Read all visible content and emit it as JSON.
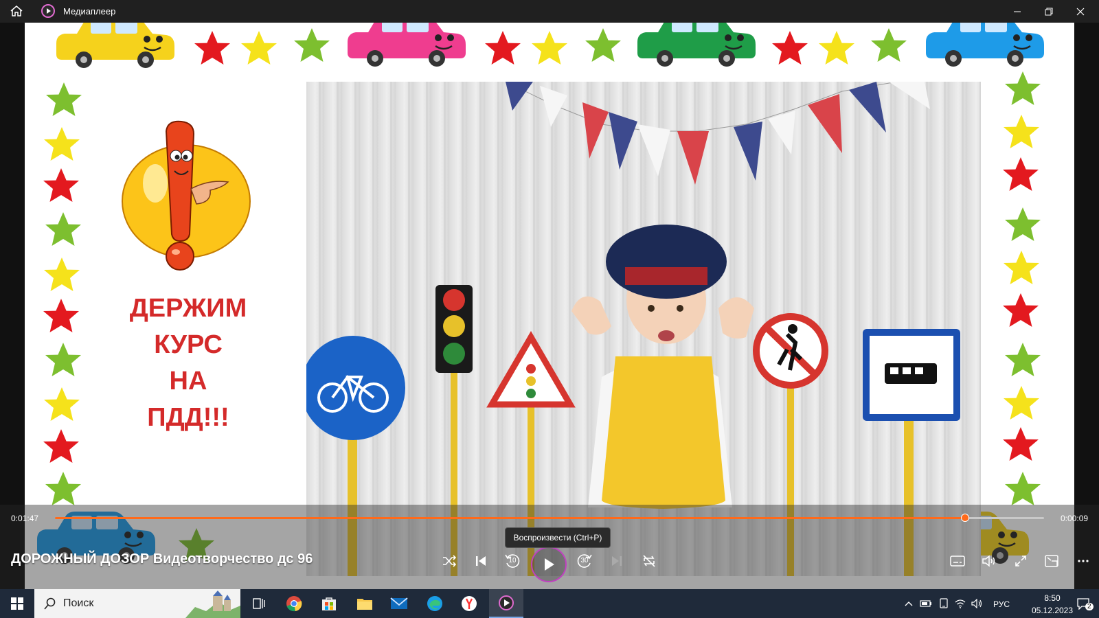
{
  "window": {
    "app_title": "Медиаплеер",
    "icons": [
      "home-icon",
      "media-player-logo-icon",
      "minimize-icon",
      "restore-icon",
      "close-icon"
    ]
  },
  "video": {
    "headline_lines": [
      "ДЕРЖИМ",
      "КУРС",
      "НА",
      "ПДД!!!"
    ],
    "colors": {
      "headline": "#d42a2a",
      "star_green": "#7dbf2f",
      "star_yellow": "#f5e21b",
      "star_red": "#e3191f"
    }
  },
  "player": {
    "elapsed": "0:01:47",
    "remaining": "0:00:09",
    "progress_fraction": 0.92,
    "media_title": "ДОРОЖНЫЙ ДОЗОР Видеотворчество дс 96",
    "tooltip": "Воспроизвести (Ctrl+P)",
    "skip_back_label": "10",
    "skip_forward_label": "30",
    "accent": "#ff6a1a",
    "icons": [
      "shuffle-icon",
      "previous-icon",
      "skip-back-10-icon",
      "play-icon",
      "skip-forward-30-icon",
      "next-icon",
      "repeat-off-icon",
      "subtitles-icon",
      "volume-icon",
      "fullscreen-icon",
      "mini-player-icon",
      "more-icon"
    ]
  },
  "taskbar": {
    "search_placeholder": "Поиск",
    "language": "РУС",
    "clock_time": "8:50",
    "clock_date": "05.12.2023",
    "notification_count": "2",
    "apps": [
      "windows-start-icon",
      "search-icon",
      "task-view-icon",
      "chrome-icon",
      "microsoft-store-icon",
      "file-explorer-icon",
      "mail-icon",
      "edge-icon",
      "yandex-icon",
      "media-player-icon"
    ],
    "tray_icons": [
      "chevron-up-icon",
      "battery-icon",
      "tablet-icon",
      "wifi-icon",
      "speaker-icon",
      "notifications-icon"
    ]
  }
}
